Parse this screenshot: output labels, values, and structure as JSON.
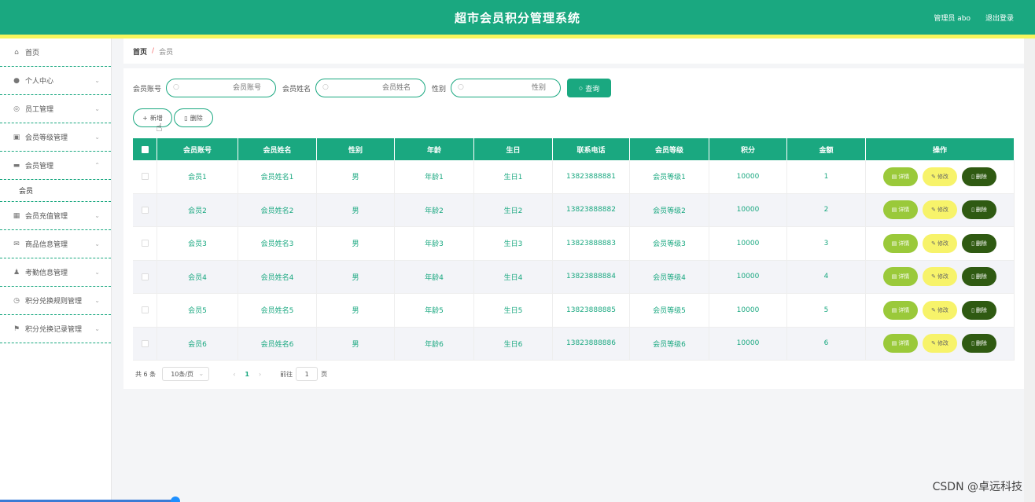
{
  "header": {
    "title": "超市会员积分管理系统",
    "user": "管理员 abo",
    "logout": "退出登录"
  },
  "sidebar": {
    "items": [
      {
        "label": "首页",
        "icon": "home-icon",
        "glyph": "⌂",
        "chev": ""
      },
      {
        "label": "个人中心",
        "icon": "person-icon",
        "glyph": "●",
        "chev": "⌄"
      },
      {
        "label": "员工管理",
        "icon": "globe-icon",
        "glyph": "◎",
        "chev": "⌄"
      },
      {
        "label": "会员等级管理",
        "icon": "chart-icon",
        "glyph": "▣",
        "chev": "⌄"
      },
      {
        "label": "会员管理",
        "icon": "chat-icon",
        "glyph": "▬",
        "chev": "⌃"
      },
      {
        "label": "会员充值管理",
        "icon": "grid-icon",
        "glyph": "▦",
        "chev": "⌄"
      },
      {
        "label": "商品信息管理",
        "icon": "mail-icon",
        "glyph": "✉",
        "chev": "⌄"
      },
      {
        "label": "考勤信息管理",
        "icon": "user-icon",
        "glyph": "♟",
        "chev": "⌄"
      },
      {
        "label": "积分兑换规则管理",
        "icon": "clock-icon",
        "glyph": "◷",
        "chev": "⌄"
      },
      {
        "label": "积分兑换记录管理",
        "icon": "flag-icon",
        "glyph": "⚑",
        "chev": "⌄"
      }
    ],
    "sub": "会员"
  },
  "breadcrumb": {
    "home": "首页",
    "sep": "/",
    "current": "会员"
  },
  "search": {
    "account_label": "会员账号",
    "account_ph": "会员账号",
    "name_label": "会员姓名",
    "name_ph": "会员姓名",
    "gender_label": "性别",
    "gender_ph": "性别",
    "query": "查询"
  },
  "actions": {
    "add": "新增",
    "delete": "删除"
  },
  "table": {
    "headers": [
      "会员账号",
      "会员姓名",
      "性别",
      "年龄",
      "生日",
      "联系电话",
      "会员等级",
      "积分",
      "金额",
      "操作"
    ],
    "rows": [
      [
        "会员1",
        "会员姓名1",
        "男",
        "年龄1",
        "生日1",
        "13823888881",
        "会员等级1",
        "10000",
        "1"
      ],
      [
        "会员2",
        "会员姓名2",
        "男",
        "年龄2",
        "生日2",
        "13823888882",
        "会员等级2",
        "10000",
        "2"
      ],
      [
        "会员3",
        "会员姓名3",
        "男",
        "年龄3",
        "生日3",
        "13823888883",
        "会员等级3",
        "10000",
        "3"
      ],
      [
        "会员4",
        "会员姓名4",
        "男",
        "年龄4",
        "生日4",
        "13823888884",
        "会员等级4",
        "10000",
        "4"
      ],
      [
        "会员5",
        "会员姓名5",
        "男",
        "年龄5",
        "生日5",
        "13823888885",
        "会员等级5",
        "10000",
        "5"
      ],
      [
        "会员6",
        "会员姓名6",
        "男",
        "年龄6",
        "生日6",
        "13823888886",
        "会员等级6",
        "10000",
        "6"
      ]
    ],
    "ops": {
      "detail": "详情",
      "edit": "修改",
      "delete": "删除"
    }
  },
  "pager": {
    "total": "共 6 条",
    "size": "10条/页",
    "page": "1",
    "goto": "前往",
    "goto_value": "1",
    "goto_suffix": "页"
  },
  "watermark": "CSDN @卓远科技",
  "colors": {
    "accent": "#1aa880",
    "yellow": "#f6f65c",
    "detail": "#9ac93a",
    "edit": "#f7f36a",
    "delete": "#2f5a12"
  }
}
